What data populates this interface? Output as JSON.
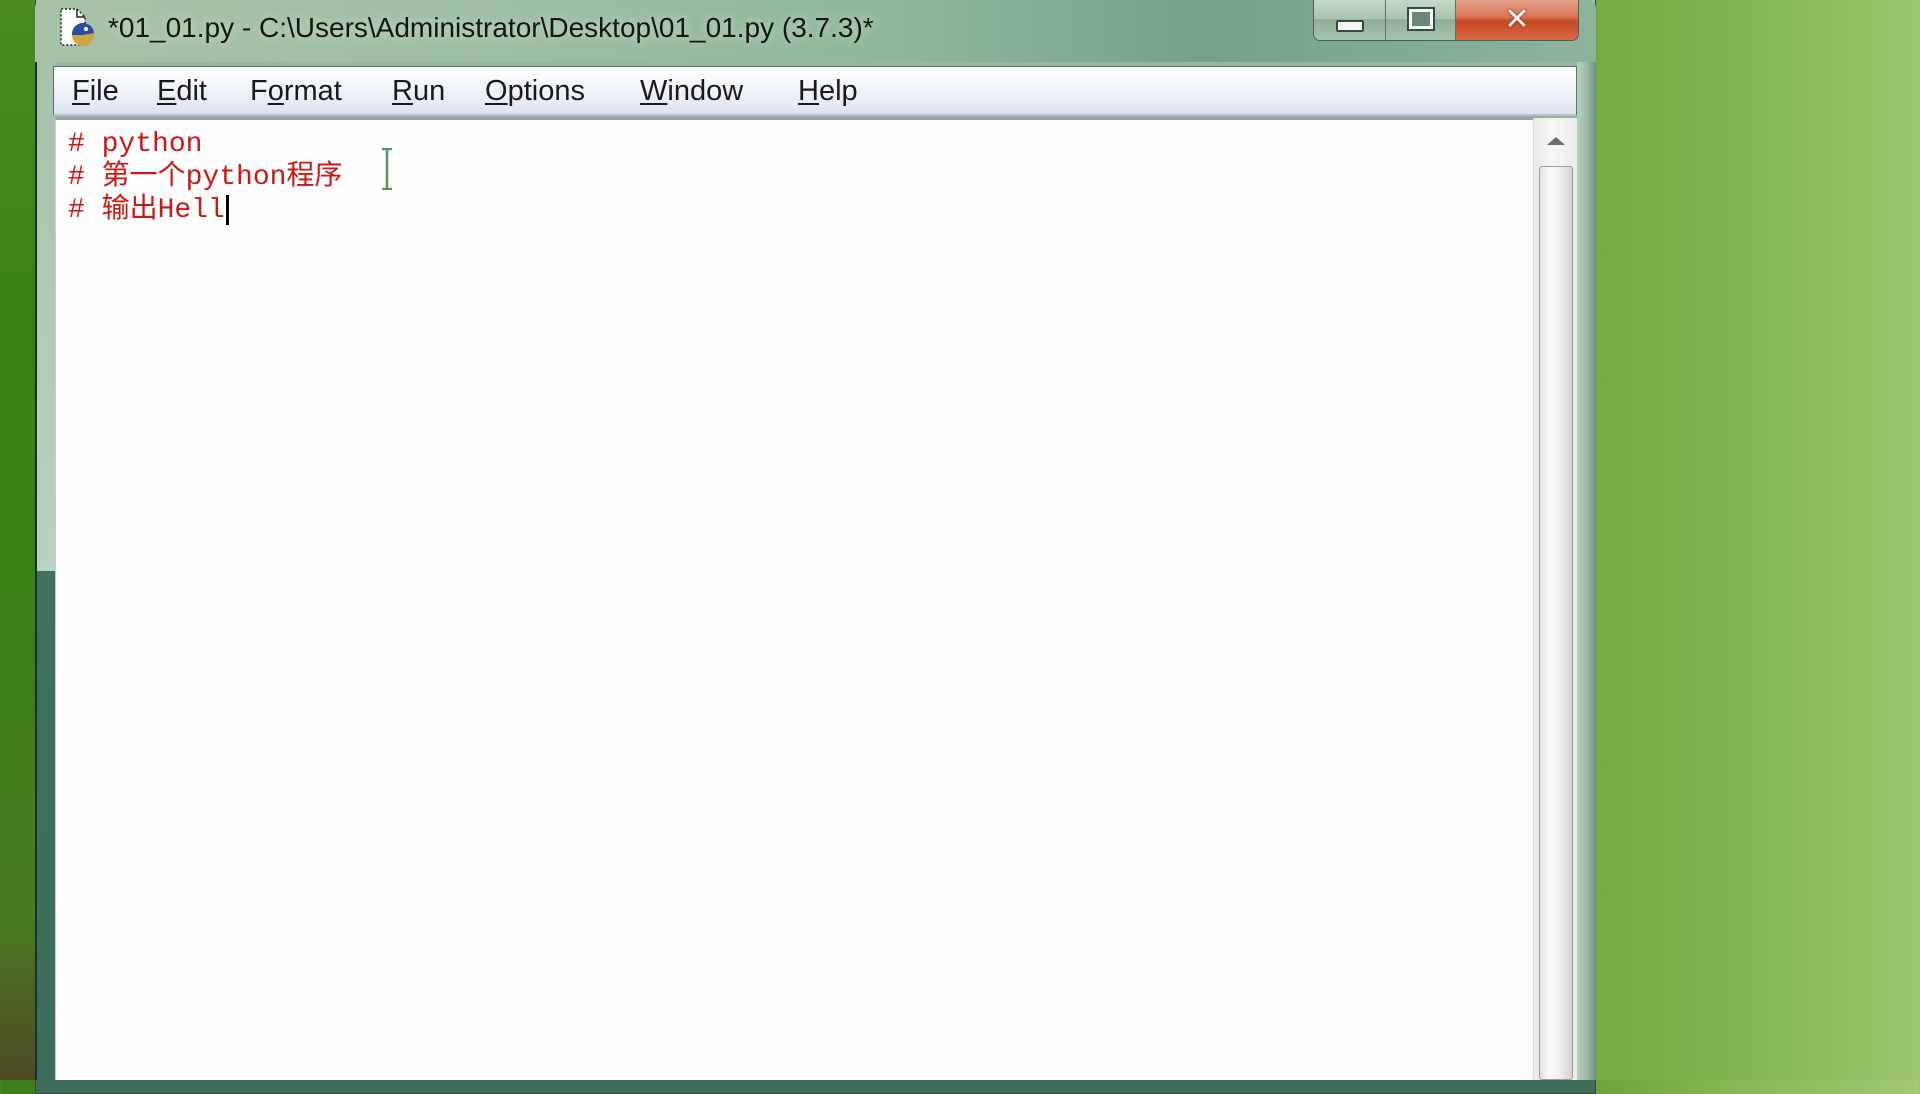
{
  "window": {
    "title": "*01_01.py - C:\\Users\\Administrator\\Desktop\\01_01.py (3.7.3)*",
    "app_icon": "python-idle-file-icon",
    "controls": {
      "minimize_icon": "minimize-icon",
      "maximize_icon": "maximize-icon",
      "close_icon": "close-icon",
      "close_glyph": "✕"
    }
  },
  "menubar": {
    "items": [
      {
        "label": "File",
        "mnemonic": "F"
      },
      {
        "label": "Edit",
        "mnemonic": "E"
      },
      {
        "label": "Format",
        "mnemonic": "o"
      },
      {
        "label": "Run",
        "mnemonic": "R"
      },
      {
        "label": "Options",
        "mnemonic": "O"
      },
      {
        "label": "Window",
        "mnemonic": "W"
      },
      {
        "label": "Help",
        "mnemonic": "H"
      }
    ]
  },
  "editor": {
    "lines": [
      "# python",
      "# 第一个python程序",
      "# 输出Hell"
    ],
    "text_color": "#c81a14",
    "caret_line": 3
  },
  "colors": {
    "desktop": "#7aae46",
    "titlebar": "#9dbda4",
    "close_button": "#c64a25",
    "menubar": "#f1f4fa",
    "editor_bg": "#fdfdfd"
  }
}
